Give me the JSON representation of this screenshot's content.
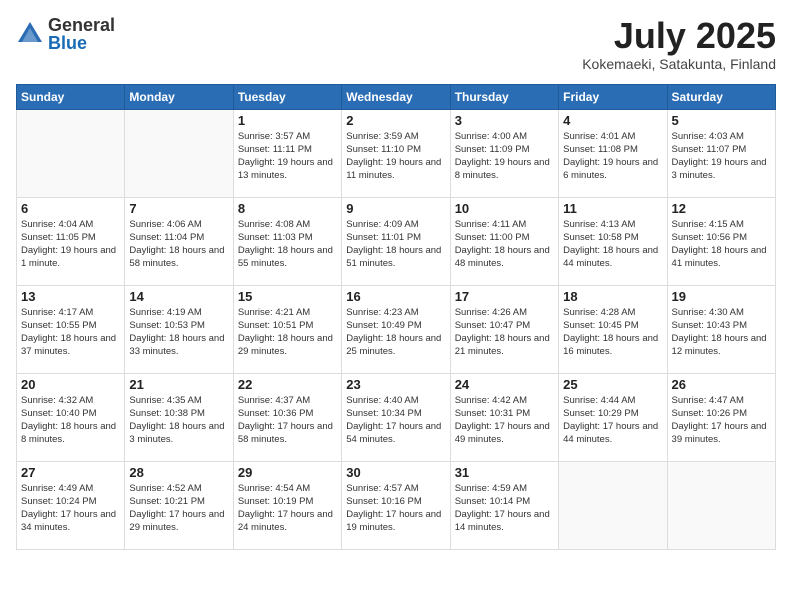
{
  "header": {
    "logo_general": "General",
    "logo_blue": "Blue",
    "month_title": "July 2025",
    "location": "Kokemaeki, Satakunta, Finland"
  },
  "days_of_week": [
    "Sunday",
    "Monday",
    "Tuesday",
    "Wednesday",
    "Thursday",
    "Friday",
    "Saturday"
  ],
  "weeks": [
    [
      {
        "day": "",
        "info": ""
      },
      {
        "day": "",
        "info": ""
      },
      {
        "day": "1",
        "info": "Sunrise: 3:57 AM\nSunset: 11:11 PM\nDaylight: 19 hours\nand 13 minutes."
      },
      {
        "day": "2",
        "info": "Sunrise: 3:59 AM\nSunset: 11:10 PM\nDaylight: 19 hours\nand 11 minutes."
      },
      {
        "day": "3",
        "info": "Sunrise: 4:00 AM\nSunset: 11:09 PM\nDaylight: 19 hours\nand 8 minutes."
      },
      {
        "day": "4",
        "info": "Sunrise: 4:01 AM\nSunset: 11:08 PM\nDaylight: 19 hours\nand 6 minutes."
      },
      {
        "day": "5",
        "info": "Sunrise: 4:03 AM\nSunset: 11:07 PM\nDaylight: 19 hours\nand 3 minutes."
      }
    ],
    [
      {
        "day": "6",
        "info": "Sunrise: 4:04 AM\nSunset: 11:05 PM\nDaylight: 19 hours\nand 1 minute."
      },
      {
        "day": "7",
        "info": "Sunrise: 4:06 AM\nSunset: 11:04 PM\nDaylight: 18 hours\nand 58 minutes."
      },
      {
        "day": "8",
        "info": "Sunrise: 4:08 AM\nSunset: 11:03 PM\nDaylight: 18 hours\nand 55 minutes."
      },
      {
        "day": "9",
        "info": "Sunrise: 4:09 AM\nSunset: 11:01 PM\nDaylight: 18 hours\nand 51 minutes."
      },
      {
        "day": "10",
        "info": "Sunrise: 4:11 AM\nSunset: 11:00 PM\nDaylight: 18 hours\nand 48 minutes."
      },
      {
        "day": "11",
        "info": "Sunrise: 4:13 AM\nSunset: 10:58 PM\nDaylight: 18 hours\nand 44 minutes."
      },
      {
        "day": "12",
        "info": "Sunrise: 4:15 AM\nSunset: 10:56 PM\nDaylight: 18 hours\nand 41 minutes."
      }
    ],
    [
      {
        "day": "13",
        "info": "Sunrise: 4:17 AM\nSunset: 10:55 PM\nDaylight: 18 hours\nand 37 minutes."
      },
      {
        "day": "14",
        "info": "Sunrise: 4:19 AM\nSunset: 10:53 PM\nDaylight: 18 hours\nand 33 minutes."
      },
      {
        "day": "15",
        "info": "Sunrise: 4:21 AM\nSunset: 10:51 PM\nDaylight: 18 hours\nand 29 minutes."
      },
      {
        "day": "16",
        "info": "Sunrise: 4:23 AM\nSunset: 10:49 PM\nDaylight: 18 hours\nand 25 minutes."
      },
      {
        "day": "17",
        "info": "Sunrise: 4:26 AM\nSunset: 10:47 PM\nDaylight: 18 hours\nand 21 minutes."
      },
      {
        "day": "18",
        "info": "Sunrise: 4:28 AM\nSunset: 10:45 PM\nDaylight: 18 hours\nand 16 minutes."
      },
      {
        "day": "19",
        "info": "Sunrise: 4:30 AM\nSunset: 10:43 PM\nDaylight: 18 hours\nand 12 minutes."
      }
    ],
    [
      {
        "day": "20",
        "info": "Sunrise: 4:32 AM\nSunset: 10:40 PM\nDaylight: 18 hours\nand 8 minutes."
      },
      {
        "day": "21",
        "info": "Sunrise: 4:35 AM\nSunset: 10:38 PM\nDaylight: 18 hours\nand 3 minutes."
      },
      {
        "day": "22",
        "info": "Sunrise: 4:37 AM\nSunset: 10:36 PM\nDaylight: 17 hours\nand 58 minutes."
      },
      {
        "day": "23",
        "info": "Sunrise: 4:40 AM\nSunset: 10:34 PM\nDaylight: 17 hours\nand 54 minutes."
      },
      {
        "day": "24",
        "info": "Sunrise: 4:42 AM\nSunset: 10:31 PM\nDaylight: 17 hours\nand 49 minutes."
      },
      {
        "day": "25",
        "info": "Sunrise: 4:44 AM\nSunset: 10:29 PM\nDaylight: 17 hours\nand 44 minutes."
      },
      {
        "day": "26",
        "info": "Sunrise: 4:47 AM\nSunset: 10:26 PM\nDaylight: 17 hours\nand 39 minutes."
      }
    ],
    [
      {
        "day": "27",
        "info": "Sunrise: 4:49 AM\nSunset: 10:24 PM\nDaylight: 17 hours\nand 34 minutes."
      },
      {
        "day": "28",
        "info": "Sunrise: 4:52 AM\nSunset: 10:21 PM\nDaylight: 17 hours\nand 29 minutes."
      },
      {
        "day": "29",
        "info": "Sunrise: 4:54 AM\nSunset: 10:19 PM\nDaylight: 17 hours\nand 24 minutes."
      },
      {
        "day": "30",
        "info": "Sunrise: 4:57 AM\nSunset: 10:16 PM\nDaylight: 17 hours\nand 19 minutes."
      },
      {
        "day": "31",
        "info": "Sunrise: 4:59 AM\nSunset: 10:14 PM\nDaylight: 17 hours\nand 14 minutes."
      },
      {
        "day": "",
        "info": ""
      },
      {
        "day": "",
        "info": ""
      }
    ]
  ]
}
